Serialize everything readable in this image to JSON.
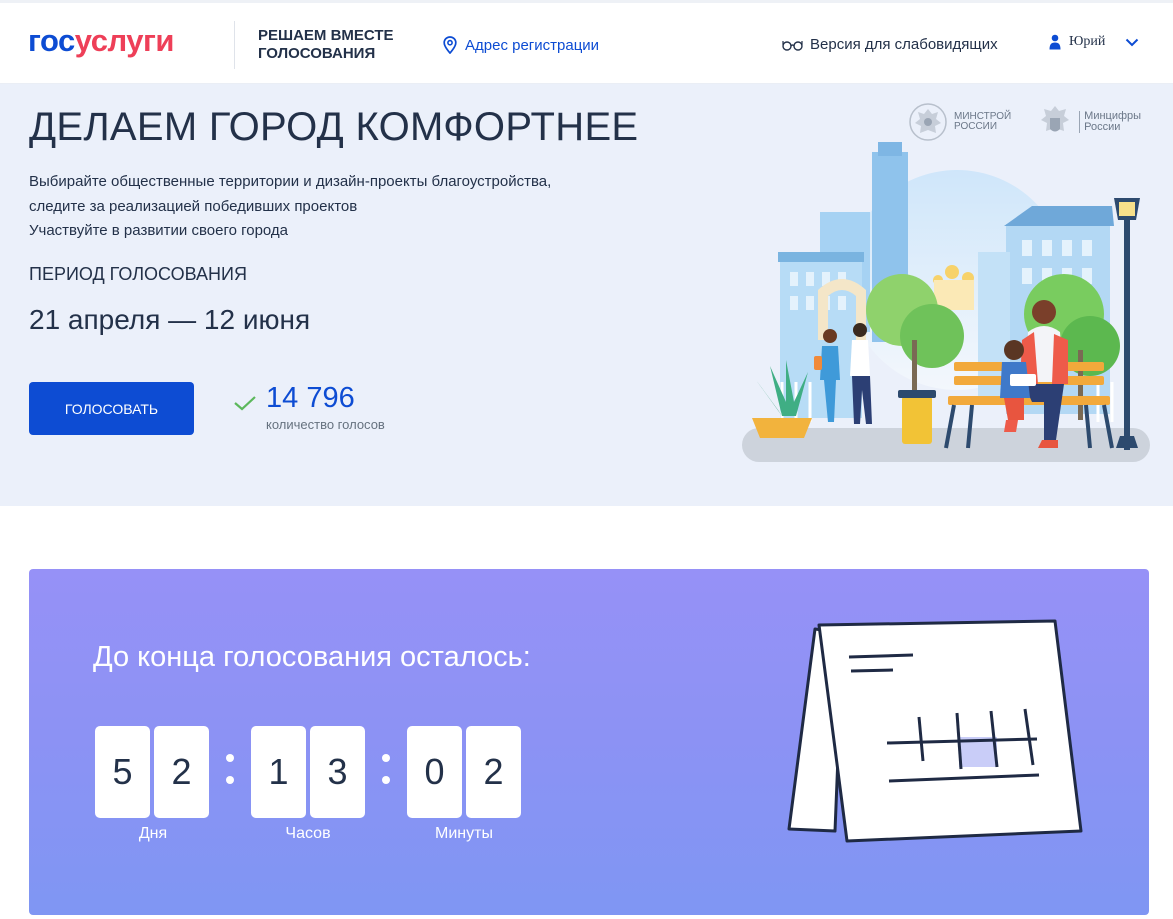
{
  "header": {
    "logo_part1": "гос",
    "logo_part2": "услуги",
    "project_line1": "Решаем вместе",
    "project_line2": "голосования",
    "address_label": "Адрес регистрации",
    "vision_label": "Версия для слабовидящих",
    "user_name": "Юрий"
  },
  "hero": {
    "title": "ДЕЛАЕМ ГОРОД КОМФОРТНЕЕ",
    "description": [
      "Выбирайте общественные территории и дизайн-проекты благоустройства,",
      "следите за реализацией победивших проектов",
      "Участвуйте в развитии своего города"
    ],
    "period_label": "Период голосования",
    "period_value": "21 апреля — 12 июня",
    "vote_button": "Голосовать",
    "votes_count": "14 796",
    "votes_label": "количество голосов",
    "partners": [
      {
        "line1": "Минстрой",
        "line2": "России"
      },
      {
        "line1": "Минцифры",
        "line2": "России"
      }
    ]
  },
  "countdown": {
    "title": "До конца голосования осталось:",
    "days_digits": [
      "5",
      "2"
    ],
    "hours_digits": [
      "1",
      "3"
    ],
    "minutes_digits": [
      "0",
      "2"
    ],
    "days_label": "Дня",
    "hours_label": "Часов",
    "minutes_label": "Минуты"
  },
  "colors": {
    "brand_blue": "#0d4cd3",
    "brand_red": "#ee3f58",
    "text_dark": "#233149",
    "hero_bg": "#ebf0fa",
    "countdown_bg": "#8d92f4",
    "check_green": "#5cb85c"
  },
  "icons": {
    "address": "map-pin-icon",
    "vision": "glasses-icon",
    "user": "user-icon",
    "chevron": "chevron-down-icon",
    "check": "check-icon"
  }
}
